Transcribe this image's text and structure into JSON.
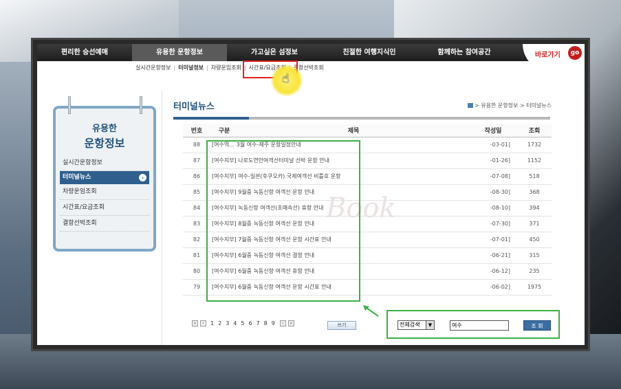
{
  "topnav": {
    "items": [
      {
        "label": "편리한 승선예매"
      },
      {
        "label": "유용한 운항정보"
      },
      {
        "label": "가고싶은 섬정보"
      },
      {
        "label": "친절한 여행지식인"
      },
      {
        "label": "함께하는 참여공간"
      }
    ],
    "goto_label": "바로가기",
    "go_label": "go"
  },
  "subnav": {
    "items": [
      {
        "label": "실시간운항정보"
      },
      {
        "label": "터미널정보"
      },
      {
        "label": "차량운임조회"
      },
      {
        "label": "시간표/요금조회"
      },
      {
        "label": "결항선박조회"
      }
    ]
  },
  "sidebar": {
    "title_line1": "유용한",
    "title_line2": "운항정보",
    "items": [
      {
        "label": "실시간운항정보"
      },
      {
        "label": "터미널뉴스"
      },
      {
        "label": "차량운임조회"
      },
      {
        "label": "시간표/요금조회"
      },
      {
        "label": "결항선박조회"
      }
    ]
  },
  "content": {
    "title": "터미널뉴스",
    "breadcrumb": "> 유용한 운항정보 > 터미널뉴스"
  },
  "table": {
    "headers": [
      "번호",
      "구분",
      "제목",
      "작성일",
      "조회"
    ],
    "rows": [
      {
        "num": "88",
        "title": "[여수역… 3월 여수-제주 운항일정안내",
        "date": "-03-01]",
        "views": "1732"
      },
      {
        "num": "87",
        "title": "[여수지부] 나로도연안여객선터미널 선박 운항 안내",
        "date": "-01-26]",
        "views": "1152"
      },
      {
        "num": "86",
        "title": "[여수지부] 여수-일본(후쿠오카) 국제여객선 비틀호 운항",
        "date": "-07-08]",
        "views": "518"
      },
      {
        "num": "85",
        "title": "[여수지부] 9월중 녹동신항 여객선 운항 안내",
        "date": "-08-30]",
        "views": "368"
      },
      {
        "num": "84",
        "title": "[여수지부] 녹동신항 여객선(초매속선) 휴항 안내",
        "date": "-08-10]",
        "views": "394"
      },
      {
        "num": "83",
        "title": "[여수지부] 8월중 녹동신항 여객선 운항 안내",
        "date": "-07-30]",
        "views": "371"
      },
      {
        "num": "82",
        "title": "[여수지부] 7월중 녹동신항 여객선 운항 시간표 안내",
        "date": "-07-01]",
        "views": "450"
      },
      {
        "num": "81",
        "title": "[여수지부] 6월중 녹동신항 여객선 결항 안내",
        "date": "-06-21]",
        "views": "315"
      },
      {
        "num": "80",
        "title": "[여수지부] 6월중 녹동신항 여객선 휴항 안내",
        "date": "-06-12]",
        "views": "235"
      },
      {
        "num": "79",
        "title": "[여수지부] 6월중 녹동신항 여객선 운항 시간표 안내",
        "date": "-06-02]",
        "views": "1975"
      }
    ]
  },
  "pager": {
    "pages": [
      "1",
      "2",
      "3",
      "4",
      "5",
      "6",
      "7",
      "8",
      "9"
    ],
    "write_label": "쓰기"
  },
  "search": {
    "select_value": "전체검색",
    "input_value": "여수",
    "button_label": "조 회"
  },
  "colors": {
    "highlight_red": "#e02020",
    "highlight_green": "#3cb043",
    "cursor_yellow": "#f7e43a",
    "brand_blue": "#2f5f8d"
  },
  "watermark": "Book"
}
